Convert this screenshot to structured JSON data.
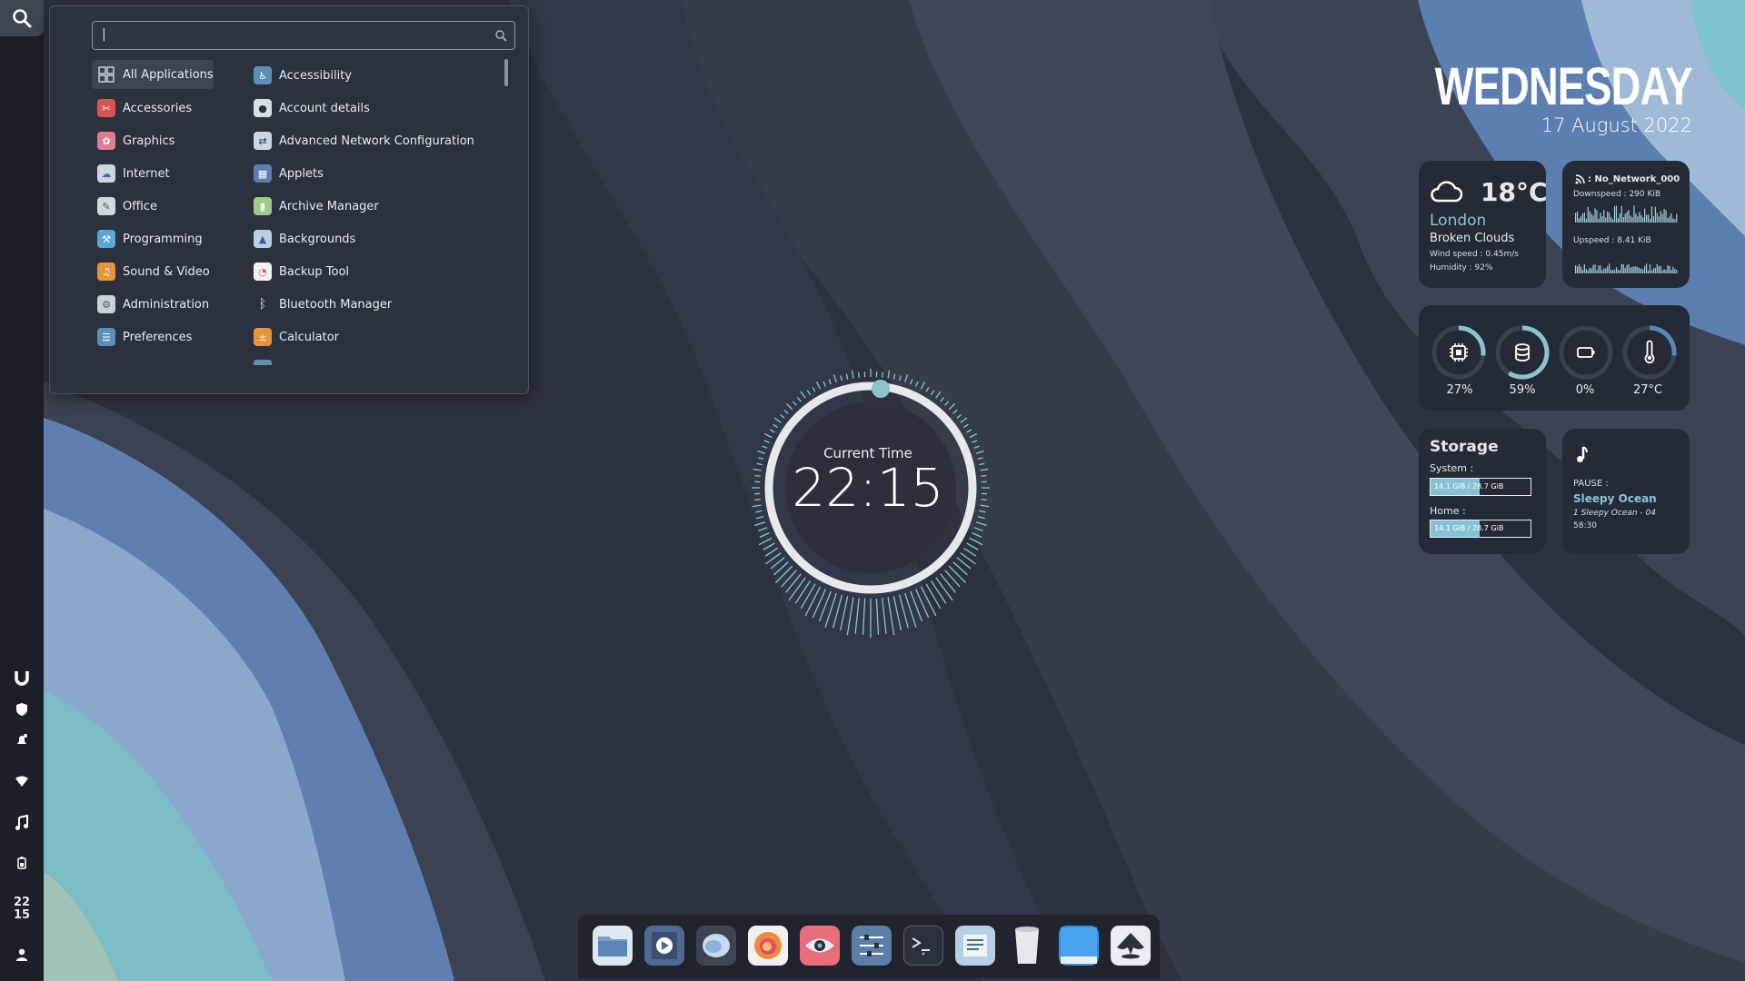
{
  "desktop": {
    "colors": {
      "panel": "#1b2028",
      "accent": "#85c3d4",
      "menu_bg": "#2b313d"
    }
  },
  "panel": {
    "search_icon": "search-icon",
    "clock_hours": "22",
    "clock_minutes": "15",
    "tray_icons": [
      "brand-u-icon",
      "shield-icon",
      "notification-bell-icon",
      "wifi-icon",
      "music-note-icon",
      "battery-icon",
      "user-icon"
    ]
  },
  "menu": {
    "search": {
      "value": "|",
      "placeholder": ""
    },
    "categories": [
      {
        "label": "All Applications",
        "icon": "grid-icon",
        "color": "#3d4452"
      },
      {
        "label": "Accessories",
        "icon": "accessories-icon",
        "color": "#d9534f"
      },
      {
        "label": "Graphics",
        "icon": "graphics-icon",
        "color": "#e07b91"
      },
      {
        "label": "Internet",
        "icon": "internet-icon",
        "color": "#c9d6e4"
      },
      {
        "label": "Office",
        "icon": "office-icon",
        "color": "#d0d7df"
      },
      {
        "label": "Programming",
        "icon": "programming-icon",
        "color": "#5aa8d6"
      },
      {
        "label": "Sound & Video",
        "icon": "sound-video-icon",
        "color": "#e8923a"
      },
      {
        "label": "Administration",
        "icon": "administration-icon",
        "color": "#c9cfd7"
      },
      {
        "label": "Preferences",
        "icon": "preferences-icon",
        "color": "#5b8fb8"
      }
    ],
    "apps": [
      {
        "label": "Accessibility",
        "icon": "accessibility-icon",
        "color": "#5b8fb8"
      },
      {
        "label": "Account details",
        "icon": "account-icon",
        "color": "#d7dde5"
      },
      {
        "label": "Advanced Network Configuration",
        "icon": "network-config-icon",
        "color": "#c9d6e4"
      },
      {
        "label": "Applets",
        "icon": "applets-icon",
        "color": "#5b7fb0"
      },
      {
        "label": "Archive Manager",
        "icon": "archive-icon",
        "color": "#9ccc8a"
      },
      {
        "label": "Backgrounds",
        "icon": "backgrounds-icon",
        "color": "#b8cfe6"
      },
      {
        "label": "Backup Tool",
        "icon": "backup-icon",
        "color": "#e35d5d"
      },
      {
        "label": "Bluetooth Manager",
        "icon": "bluetooth-icon",
        "color": "transparent"
      },
      {
        "label": "Calculator",
        "icon": "calculator-icon",
        "color": "#e8923a"
      }
    ]
  },
  "clock": {
    "label": "Current Time",
    "time": "22:15"
  },
  "header": {
    "day": "WEDNESDAY",
    "date": "17 August 2022"
  },
  "weather": {
    "icon": "cloud-icon",
    "temp": "18°C",
    "city": "London",
    "condition": "Broken Clouds",
    "wind": "Wind speed : 0.45m/s",
    "humidity": "Humidity : 92%"
  },
  "network": {
    "icon": "wifi-signal-icon",
    "name": ": No_Network_000",
    "down": "Downspeed : 290 KiB",
    "up": "Upspeed : 8.41 KiB"
  },
  "system": {
    "gauges": [
      {
        "icon": "cpu-icon",
        "value": 27,
        "label": "27%"
      },
      {
        "icon": "disk-icon",
        "value": 59,
        "label": "59%"
      },
      {
        "icon": "battery-icon",
        "value": 0,
        "label": "0%"
      },
      {
        "icon": "thermometer-icon",
        "value": 27,
        "label": "27°C"
      }
    ]
  },
  "storage": {
    "title": "Storage",
    "system_label": "System :",
    "system_value": "14.1 GiB / 28.7 GiB",
    "system_fill": 0.49,
    "home_label": "Home :",
    "home_value": "14.1 GiB / 28.7 GiB",
    "home_fill": 0.49
  },
  "music": {
    "icon": "music-note-icon",
    "status": "PAUSE :",
    "title": "Sleepy Ocean",
    "track": "1 Sleepy Ocean - 04",
    "time": "58:30"
  },
  "dock": {
    "apps": [
      "file-manager-icon",
      "video-player-icon",
      "chat-icon",
      "firefox-icon",
      "eye-viewer-icon",
      "settings-mixer-icon",
      "terminal-icon",
      "text-editor-icon",
      "trash-icon",
      "desktop-icon",
      "inkscape-icon"
    ]
  }
}
